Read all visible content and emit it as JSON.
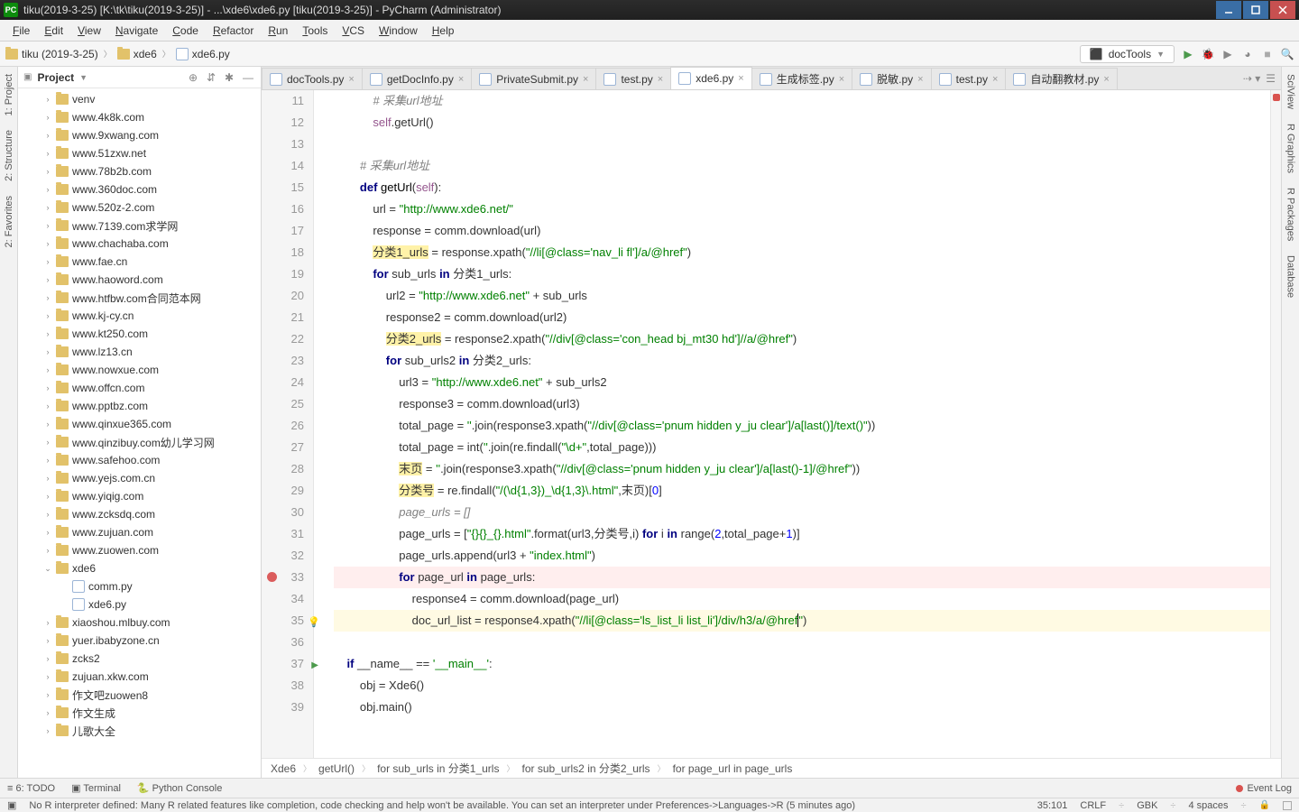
{
  "window": {
    "title": "tiku(2019-3-25) [K:\\tk\\tiku(2019-3-25)] - ...\\xde6\\xde6.py [tiku(2019-3-25)] - PyCharm (Administrator)"
  },
  "menu": [
    "File",
    "Edit",
    "View",
    "Navigate",
    "Code",
    "Refactor",
    "Run",
    "Tools",
    "VCS",
    "Window",
    "Help"
  ],
  "nav_crumbs": [
    {
      "type": "folder",
      "label": "tiku (2019-3-25)"
    },
    {
      "type": "folder",
      "label": "xde6"
    },
    {
      "type": "py",
      "label": "xde6.py"
    }
  ],
  "run_config": "docTools",
  "project_header": "Project",
  "tree": [
    {
      "label": "venv",
      "icon": "folder",
      "expand": ">"
    },
    {
      "label": "www.4k8k.com",
      "icon": "folder",
      "expand": ">"
    },
    {
      "label": "www.9xwang.com",
      "icon": "folder",
      "expand": ">"
    },
    {
      "label": "www.51zxw.net",
      "icon": "folder",
      "expand": ">"
    },
    {
      "label": "www.78b2b.com",
      "icon": "folder",
      "expand": ">"
    },
    {
      "label": "www.360doc.com",
      "icon": "folder",
      "expand": ">"
    },
    {
      "label": "www.520z-2.com",
      "icon": "folder",
      "expand": ">"
    },
    {
      "label": "www.7139.com求学网",
      "icon": "folder",
      "expand": ">"
    },
    {
      "label": "www.chachaba.com",
      "icon": "folder",
      "expand": ">"
    },
    {
      "label": "www.fae.cn",
      "icon": "folder",
      "expand": ">"
    },
    {
      "label": "www.haoword.com",
      "icon": "folder",
      "expand": ">"
    },
    {
      "label": "www.htfbw.com合同范本网",
      "icon": "folder",
      "expand": ">"
    },
    {
      "label": "www.kj-cy.cn",
      "icon": "folder",
      "expand": ">"
    },
    {
      "label": "www.kt250.com",
      "icon": "folder",
      "expand": ">"
    },
    {
      "label": "www.lz13.cn",
      "icon": "folder",
      "expand": ">"
    },
    {
      "label": "www.nowxue.com",
      "icon": "folder",
      "expand": ">"
    },
    {
      "label": "www.offcn.com",
      "icon": "folder",
      "expand": ">"
    },
    {
      "label": "www.pptbz.com",
      "icon": "folder",
      "expand": ">"
    },
    {
      "label": "www.qinxue365.com",
      "icon": "folder",
      "expand": ">"
    },
    {
      "label": "www.qinzibuy.com幼儿学习网",
      "icon": "folder",
      "expand": ">"
    },
    {
      "label": "www.safehoo.com",
      "icon": "folder",
      "expand": ">"
    },
    {
      "label": "www.yejs.com.cn",
      "icon": "folder",
      "expand": ">"
    },
    {
      "label": "www.yiqig.com",
      "icon": "folder",
      "expand": ">"
    },
    {
      "label": "www.zcksdq.com",
      "icon": "folder",
      "expand": ">"
    },
    {
      "label": "www.zujuan.com",
      "icon": "folder",
      "expand": ">"
    },
    {
      "label": "www.zuowen.com",
      "icon": "folder",
      "expand": ">"
    },
    {
      "label": "xde6",
      "icon": "folder",
      "expand": "v",
      "children": [
        {
          "label": "comm.py",
          "icon": "py"
        },
        {
          "label": "xde6.py",
          "icon": "py"
        }
      ]
    },
    {
      "label": "xiaoshou.mlbuy.com",
      "icon": "folder",
      "expand": ">"
    },
    {
      "label": "yuer.ibabyzone.cn",
      "icon": "folder",
      "expand": ">"
    },
    {
      "label": "zcks2",
      "icon": "folder",
      "expand": ">"
    },
    {
      "label": "zujuan.xkw.com",
      "icon": "folder",
      "expand": ">"
    },
    {
      "label": "作文吧zuowen8",
      "icon": "folder",
      "expand": ">"
    },
    {
      "label": "作文生成",
      "icon": "folder",
      "expand": ">"
    },
    {
      "label": "儿歌大全",
      "icon": "folder",
      "expand": ">"
    }
  ],
  "tabs": [
    {
      "label": "docTools.py",
      "active": false
    },
    {
      "label": "getDocInfo.py",
      "active": false
    },
    {
      "label": "PrivateSubmit.py",
      "active": false
    },
    {
      "label": "test.py",
      "active": false
    },
    {
      "label": "xde6.py",
      "active": true
    },
    {
      "label": "生成标签.py",
      "active": false
    },
    {
      "label": "脱敏.py",
      "active": false
    },
    {
      "label": "test.py",
      "active": false
    },
    {
      "label": "自动翻教材.py",
      "active": false
    }
  ],
  "code_lines": [
    {
      "n": 11,
      "html": "            <span class='com'># 采集url地址</span>"
    },
    {
      "n": 12,
      "html": "            <span class='self'>self</span>.getUrl()"
    },
    {
      "n": 13,
      "html": ""
    },
    {
      "n": 14,
      "html": "        <span class='com'># 采集url地址</span>"
    },
    {
      "n": 15,
      "html": "        <span class='kw'>def</span> <span class='fn'>getUrl</span>(<span class='self'>self</span>):"
    },
    {
      "n": 16,
      "html": "            url = <span class='str'>\"http://www.xde6.net/\"</span>"
    },
    {
      "n": 17,
      "html": "            response = comm.download(url)"
    },
    {
      "n": 18,
      "html": "            <span class='hl-y'>分类1_urls</span> = response.xpath(<span class='str'>\"//li[@class='nav_li fl']/a/@href\"</span>)"
    },
    {
      "n": 19,
      "html": "            <span class='kw'>for</span> sub_urls <span class='kw'>in</span> 分类1_urls:"
    },
    {
      "n": 20,
      "html": "                url2 = <span class='str'>\"http://www.xde6.net\"</span> + sub_urls"
    },
    {
      "n": 21,
      "html": "                response2 = comm.download(url2)"
    },
    {
      "n": 22,
      "html": "                <span class='hl-y'>分类2_urls</span> = response2.xpath(<span class='str'>\"//div[@class='con_head bj_mt30 hd']//a/@href\"</span>)"
    },
    {
      "n": 23,
      "html": "                <span class='kw'>for</span> sub_urls2 <span class='kw'>in</span> 分类2_urls:"
    },
    {
      "n": 24,
      "html": "                    url3 = <span class='str'>\"http://www.xde6.net\"</span> + sub_urls2"
    },
    {
      "n": 25,
      "html": "                    response3 = comm.download(url3)"
    },
    {
      "n": 26,
      "html": "                    total_page = <span class='str'>''</span>.join(response3.xpath(<span class='str'>\"//div[@class='pnum hidden y_ju clear']/a[last()]/text()\"</span>))"
    },
    {
      "n": 27,
      "html": "                    total_page = int(<span class='str'>''</span>.join(re.findall(<span class='str'>\"\\d+\"</span>,total_page)))"
    },
    {
      "n": 28,
      "html": "                    <span class='hl-y'>末页</span> = <span class='str'>''</span>.join(response3.xpath(<span class='str'>\"//div[@class='pnum hidden y_ju clear']/a[last()-1]/@href\"</span>))"
    },
    {
      "n": 29,
      "html": "                    <span class='hl-y'>分类号</span> = re.findall(<span class='str'>\"/(\\d{1,3})_\\d{1,3}\\.html\"</span>,末页)[<span class='num'>0</span>]"
    },
    {
      "n": 30,
      "html": "                    <span class='com'>page_urls = []</span>"
    },
    {
      "n": 31,
      "html": "                    page_urls = [<span class='str'>\"{}{}_{}.html\"</span>.format(url3,分类号,i) <span class='kw'>for</span> i <span class='kw'>in</span> range(<span class='num'>2</span>,total_page+<span class='num'>1</span>)]"
    },
    {
      "n": 32,
      "html": "                    page_urls.append(url3 + <span class='str'>\"index.html\"</span>)"
    },
    {
      "n": 33,
      "html": "                    <span class='kw'>for</span> page_url <span class='kw'>in</span> page_urls:",
      "cls": "hl-break",
      "bp": true
    },
    {
      "n": 34,
      "html": "                        response4 = comm.download(page_url)"
    },
    {
      "n": 35,
      "html": "                        doc_url_list = response4.xpath(<span class='str'>\"//li[@class='ls_list_li list_li']/div/h3/a/@href<span style='border-left:1px solid #000'></span>\"</span>)",
      "cls": "hl-caret",
      "bulb": true
    },
    {
      "n": 36,
      "html": ""
    },
    {
      "n": 37,
      "html": "    <span class='kw'>if</span> __name__ == <span class='str'>'__main__'</span>:",
      "play": true
    },
    {
      "n": 38,
      "html": "        obj = Xde6()"
    },
    {
      "n": 39,
      "html": "        obj.main()"
    }
  ],
  "breadcrumb": [
    "Xde6",
    "getUrl()",
    "for sub_urls in 分类1_urls",
    "for sub_urls2 in 分类2_urls",
    "for page_url in page_urls"
  ],
  "bottom_tools": [
    "≡ 6: TODO",
    "▣ Terminal",
    "🐍 Python Console"
  ],
  "event_log": "Event Log",
  "status": {
    "msg": "No R interpreter defined: Many R related features like completion, code checking and help won't be available. You can set an interpreter under Preferences->Languages->R (5 minutes ago)",
    "pos": "35:101",
    "eol": "CRLF",
    "enc": "GBK",
    "indent": "4 spaces",
    "branch": ""
  },
  "left_tabs": [
    "1: Project",
    "2: Structure",
    "2: Favorites"
  ],
  "right_tabs": [
    "SciView",
    "R Graphics",
    "R Packages",
    "Database"
  ]
}
